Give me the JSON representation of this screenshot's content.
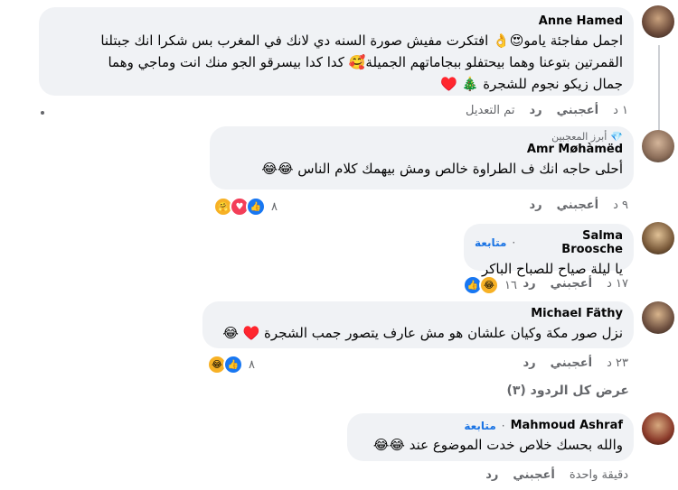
{
  "comments": [
    {
      "author": "Anne Hamed",
      "text1": "اجمل مفاجئة يامو😍👌 افتكرت مفيش صورة السنه دي لانك في المغرب بس شكرا انك جبتلنا",
      "text2": "القمرتين بتوعنا وهما بيحتفلو ببجاماتهم الجميلة🥰 كدا كدا بيسرقو الجو منك انت وماجي وهما",
      "text3": "جمال زيكو نجوم للشجرة 🎄 ♥️",
      "time": "١ د",
      "like": "أعجبني",
      "reply": "رد",
      "edited": "تم التعديل"
    },
    {
      "badge": "أبرز المعجبين",
      "author": "Amr Møhàmëd",
      "text1": "أحلى حاجه انك ف الطراوة خالص ومش بيهمك كلام الناس 😂😂",
      "time": "٩ د",
      "like": "أعجبني",
      "reply": "رد",
      "reaction_count": "٨"
    },
    {
      "author": "Salma Broosche",
      "follow": "متابعة",
      "text1": "يا ليلة صياح للصباح الباكر",
      "time": "١٧ د",
      "like": "أعجبني",
      "reply": "رد",
      "reaction_count": "١٦"
    },
    {
      "author": "Michael Fäthy",
      "text1": "نزل صور مكة وكيان علشان هو مش عارف يتصور جمب الشجرة ♥️ 😂",
      "time": "٢٣ د",
      "like": "أعجبني",
      "reply": "رد",
      "reaction_count": "٨"
    },
    {
      "author": "Mahmoud Ashraf",
      "follow": "متابعة",
      "text1": "والله بحسك خلاص خدت الموضوع عند 😂😂",
      "time": "دقيقة واحدة",
      "like": "أعجبني",
      "reply": "رد"
    }
  ],
  "view_all": "عرض كل الردود (٣)",
  "colors": {
    "bubble": "#f0f2f5",
    "link": "#1b74e4",
    "meta": "#65676b"
  }
}
